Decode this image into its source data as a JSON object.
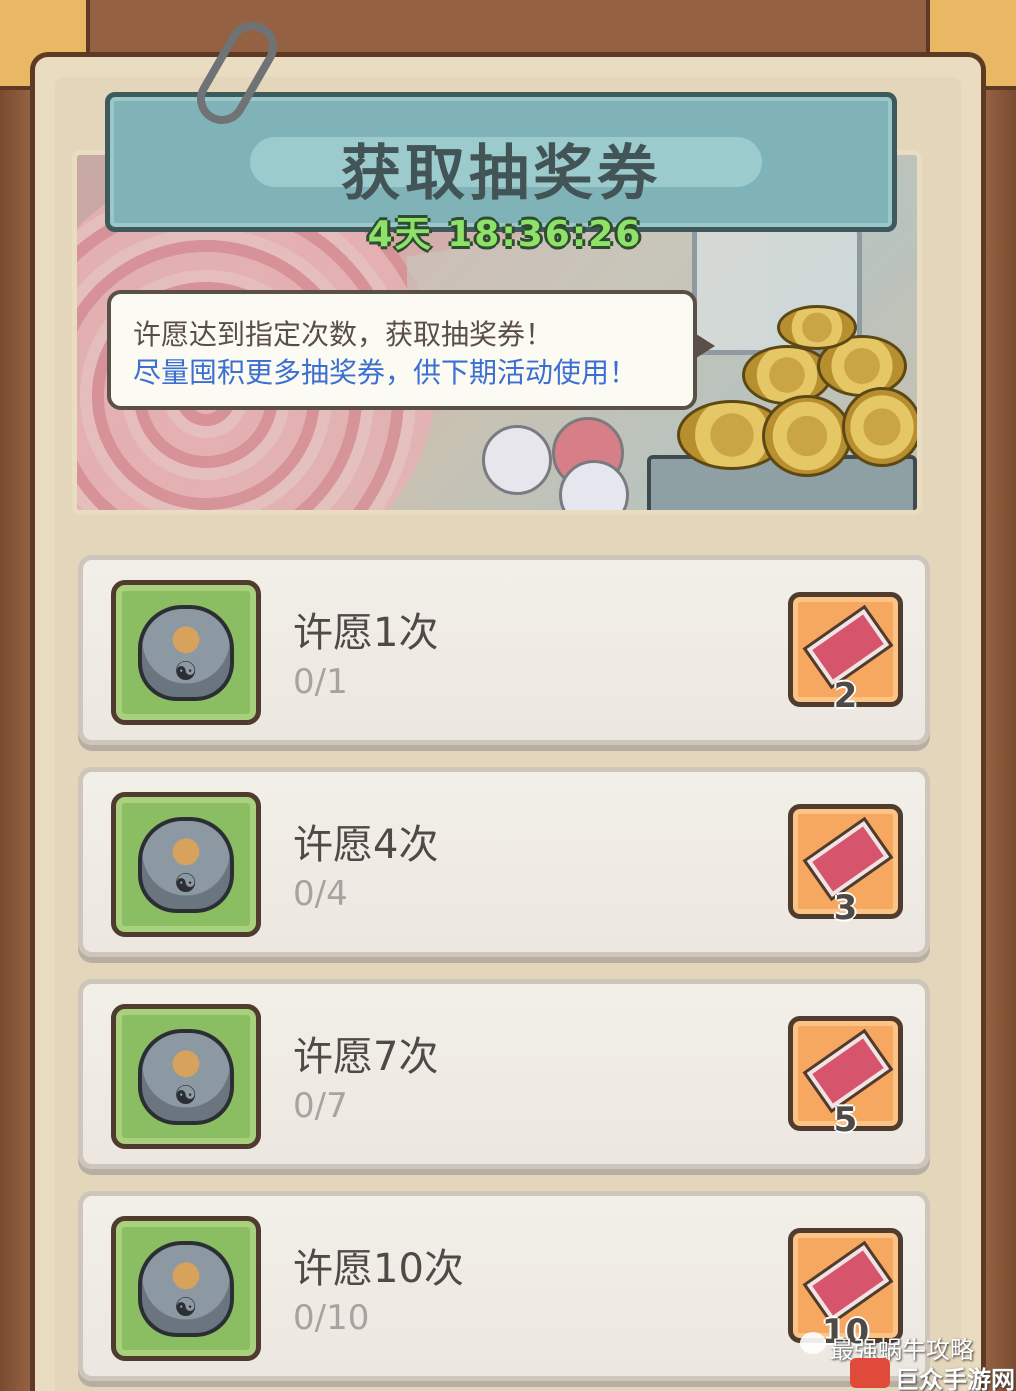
{
  "header": {
    "title": "获取抽奖券",
    "timer": "4天 18:36:26"
  },
  "info": {
    "line1": "许愿达到指定次数，获取抽奖券！",
    "line2": "尽量囤积更多抽奖券，供下期活动使用！"
  },
  "tasks": [
    {
      "name": "许愿1次",
      "progress": "0/1",
      "reward_count": "2"
    },
    {
      "name": "许愿4次",
      "progress": "0/4",
      "reward_count": "3"
    },
    {
      "name": "许愿7次",
      "progress": "0/7",
      "reward_count": "5"
    },
    {
      "name": "许愿10次",
      "progress": "0/10",
      "reward_count": "10"
    }
  ],
  "watermark": {
    "line1": "最强蜗牛攻略",
    "line2": "巨众手游网"
  },
  "icons": {
    "task_icon": "cauldron-icon",
    "reward_icon": "ticket-icon"
  }
}
